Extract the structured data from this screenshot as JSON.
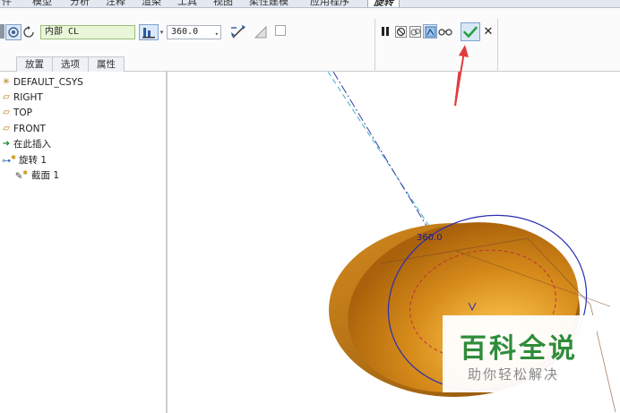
{
  "menu": {
    "items": [
      "件",
      "模型",
      "分析",
      "注释",
      "渲染",
      "工具",
      "视图",
      "柔性建模",
      "应用程序",
      "旋转"
    ],
    "active_index": 9
  },
  "dashboard": {
    "axis_value": "内部 CL",
    "angle_value": "360.0",
    "tabs": [
      "放置",
      "选项",
      "属性"
    ]
  },
  "model_tree": {
    "items": [
      {
        "label": "DEFAULT_CSYS",
        "icon": "csys-icon"
      },
      {
        "label": "RIGHT",
        "icon": "datum-plane-icon"
      },
      {
        "label": "TOP",
        "icon": "datum-plane-icon"
      },
      {
        "label": "FRONT",
        "icon": "datum-plane-icon"
      },
      {
        "label": "在此插入",
        "icon": "insert-here-arrow-icon"
      },
      {
        "label": "旋转 1",
        "icon": "revolve-feature-icon"
      },
      {
        "label": "截面 1",
        "icon": "sketch-section-icon"
      }
    ]
  },
  "graphics": {
    "dimension_label": "360.0",
    "colors": {
      "solid_body": "#c97c10",
      "solid_highlight": "#fff2a0",
      "sketch_line": "#2a2fb0",
      "hidden_edge": "#c0303a",
      "axis_line": "#3fb0c8",
      "pointer_arrow": "#e23b3b",
      "confirm_green": "#2aa042"
    }
  },
  "watermark": {
    "title": "百科全说",
    "subtitle": "助你轻松解决"
  }
}
